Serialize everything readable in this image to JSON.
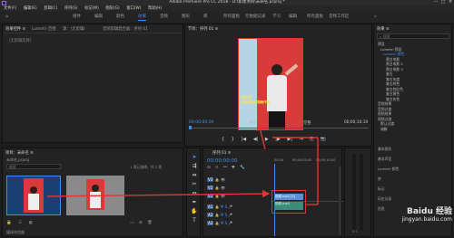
{
  "title": "Adobe Premiere Pro CC 2018 - D:\\新建项目\\未命名.prproj *",
  "window": {
    "minimize": "—",
    "maximize": "□",
    "close": "✕"
  },
  "menu": [
    "文件(F)",
    "编辑(E)",
    "剪辑(C)",
    "序列(S)",
    "标记(M)",
    "图形(G)",
    "窗口(W)",
    "帮助(H)"
  ],
  "workspaces": [
    "组件",
    "编辑",
    "颜色",
    "效果",
    "音频",
    "图形",
    "库",
    "所有面板",
    "元数据记录",
    "学习",
    "编辑",
    "所有面板",
    "音频工作区"
  ],
  "workspace_active_index": 3,
  "source_panel": {
    "tabs": [
      "效果控件 ≡",
      "Lumetri 范围",
      "源：(无剪辑)",
      "音频剪辑混合器：序列 01"
    ],
    "message": "（无剪辑选择）"
  },
  "program_monitor": {
    "title": "节目：序列 01 ≡",
    "caption": "这是我的短视频作品",
    "caption_top": "你好呀",
    "timecode_left": "00;00;00;00",
    "fit": "适合",
    "quality": "完整",
    "timecode_right": "00;00;10;10",
    "controls": [
      "⇤",
      "{",
      "}",
      "|◀",
      "◀|",
      "▶",
      "|▶",
      "▶|",
      "⇥",
      "⎘",
      "📷"
    ]
  },
  "effects_panel": {
    "title": "效果 ≡",
    "search_placeholder": "搜索",
    "tree": [
      "预设",
      "Lumetri 预设",
      "Lumetri 颜色",
      "黑白电影",
      "黑白电影 2",
      "黑白电影 3",
      "复古",
      "复古灰度",
      "复古棕色",
      "复古棕红色",
      "复古黄色",
      "复古灰色",
      "音频效果",
      "音频过渡",
      "视频效果",
      "视频过渡",
      "默认过渡",
      "溶解"
    ],
    "lower_items": [
      "基本图形",
      "基本声音",
      "Lumetri 颜色",
      "库",
      "标记",
      "历史记录",
      "信息"
    ]
  },
  "project_panel": {
    "title": "项目：未命名 ≡",
    "subtitle": "未命名.prproj",
    "search_placeholder": "搜索",
    "count": "1 项已选择，共 2 项",
    "bottom_label": "媒体浏览器"
  },
  "timeline": {
    "title": "序列 01 ≡",
    "timecode": "00;00;00;00",
    "ruler": [
      "00;00",
      "00;00;05;00",
      "00;00;10;00"
    ],
    "video_tracks": [
      "V3",
      "V2",
      "V1"
    ],
    "audio_tracks": [
      "A1",
      "A2",
      "A3"
    ],
    "clip_label": "视频.mp4 [V]",
    "audio_clip_label": "视频.mp4"
  },
  "tools": [
    "selection-tool",
    "track-select-tool",
    "ripple-edit-tool",
    "razor-tool",
    "slip-tool",
    "pen-tool",
    "hand-tool",
    "type-tool"
  ],
  "watermark": "Baidu 经验",
  "watermark_url": "jingyan.baidu.com",
  "colors": {
    "accent": "#3f8fe8",
    "highlight": "#e53232",
    "bg": "#1d1d1d",
    "panel": "#232323"
  }
}
